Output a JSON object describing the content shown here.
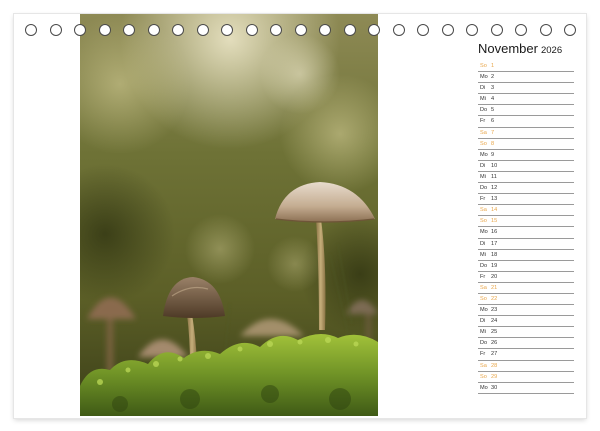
{
  "calendar": {
    "month": "November",
    "year": "2026",
    "weekend_color": "#e8a64a",
    "days": [
      {
        "name": "So",
        "day": "1",
        "weekend": true
      },
      {
        "name": "Mo",
        "day": "2",
        "weekend": false
      },
      {
        "name": "Di",
        "day": "3",
        "weekend": false
      },
      {
        "name": "Mi",
        "day": "4",
        "weekend": false
      },
      {
        "name": "Do",
        "day": "5",
        "weekend": false
      },
      {
        "name": "Fr",
        "day": "6",
        "weekend": false
      },
      {
        "name": "Sa",
        "day": "7",
        "weekend": true
      },
      {
        "name": "So",
        "day": "8",
        "weekend": true
      },
      {
        "name": "Mo",
        "day": "9",
        "weekend": false
      },
      {
        "name": "Di",
        "day": "10",
        "weekend": false
      },
      {
        "name": "Mi",
        "day": "11",
        "weekend": false
      },
      {
        "name": "Do",
        "day": "12",
        "weekend": false
      },
      {
        "name": "Fr",
        "day": "13",
        "weekend": false
      },
      {
        "name": "Sa",
        "day": "14",
        "weekend": true
      },
      {
        "name": "So",
        "day": "15",
        "weekend": true
      },
      {
        "name": "Mo",
        "day": "16",
        "weekend": false
      },
      {
        "name": "Di",
        "day": "17",
        "weekend": false
      },
      {
        "name": "Mi",
        "day": "18",
        "weekend": false
      },
      {
        "name": "Do",
        "day": "19",
        "weekend": false
      },
      {
        "name": "Fr",
        "day": "20",
        "weekend": false
      },
      {
        "name": "Sa",
        "day": "21",
        "weekend": true
      },
      {
        "name": "So",
        "day": "22",
        "weekend": true
      },
      {
        "name": "Mo",
        "day": "23",
        "weekend": false
      },
      {
        "name": "Di",
        "day": "24",
        "weekend": false
      },
      {
        "name": "Mi",
        "day": "25",
        "weekend": false
      },
      {
        "name": "Do",
        "day": "26",
        "weekend": false
      },
      {
        "name": "Fr",
        "day": "27",
        "weekend": false
      },
      {
        "name": "Sa",
        "day": "28",
        "weekend": true
      },
      {
        "name": "So",
        "day": "29",
        "weekend": true
      },
      {
        "name": "Mo",
        "day": "30",
        "weekend": false
      }
    ]
  }
}
